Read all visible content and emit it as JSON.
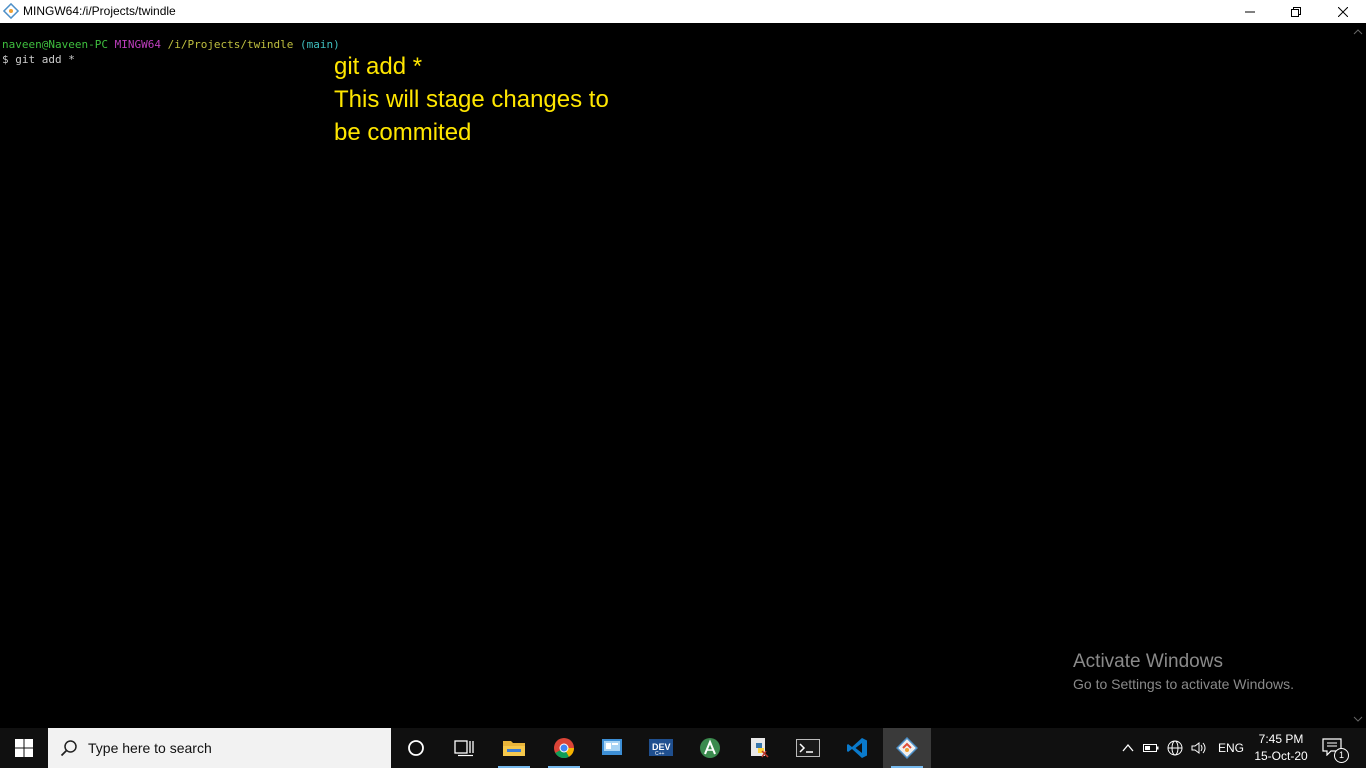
{
  "window": {
    "title": "MINGW64:/i/Projects/twindle",
    "controls": {
      "minimize": "minimize",
      "maximize": "restore",
      "close": "close"
    }
  },
  "terminal": {
    "prompt": {
      "user_host": "naveen@Naveen-PC",
      "system": "MINGW64",
      "path": "/i/Projects/twindle",
      "branch": "(main)"
    },
    "command": "$ git add *"
  },
  "annotation": {
    "lines": [
      "git add *",
      "This will stage changes to",
      "be commited"
    ],
    "color": "#ffe600"
  },
  "watermark": {
    "title": "Activate Windows",
    "subtitle": "Go to Settings to activate Windows."
  },
  "taskbar": {
    "search_placeholder": "Type here to search",
    "apps": [
      {
        "name": "cortana-icon"
      },
      {
        "name": "task-view-icon"
      },
      {
        "name": "file-explorer-icon"
      },
      {
        "name": "chrome-icon"
      },
      {
        "name": "control-panel-icon"
      },
      {
        "name": "dev-cpp-icon"
      },
      {
        "name": "android-studio-icon"
      },
      {
        "name": "python-icon"
      },
      {
        "name": "terminal-icon"
      },
      {
        "name": "vscode-icon"
      },
      {
        "name": "git-bash-icon"
      }
    ],
    "language": "ENG",
    "time": "7:45 PM",
    "date": "15-Oct-20",
    "notification_count": "1"
  }
}
